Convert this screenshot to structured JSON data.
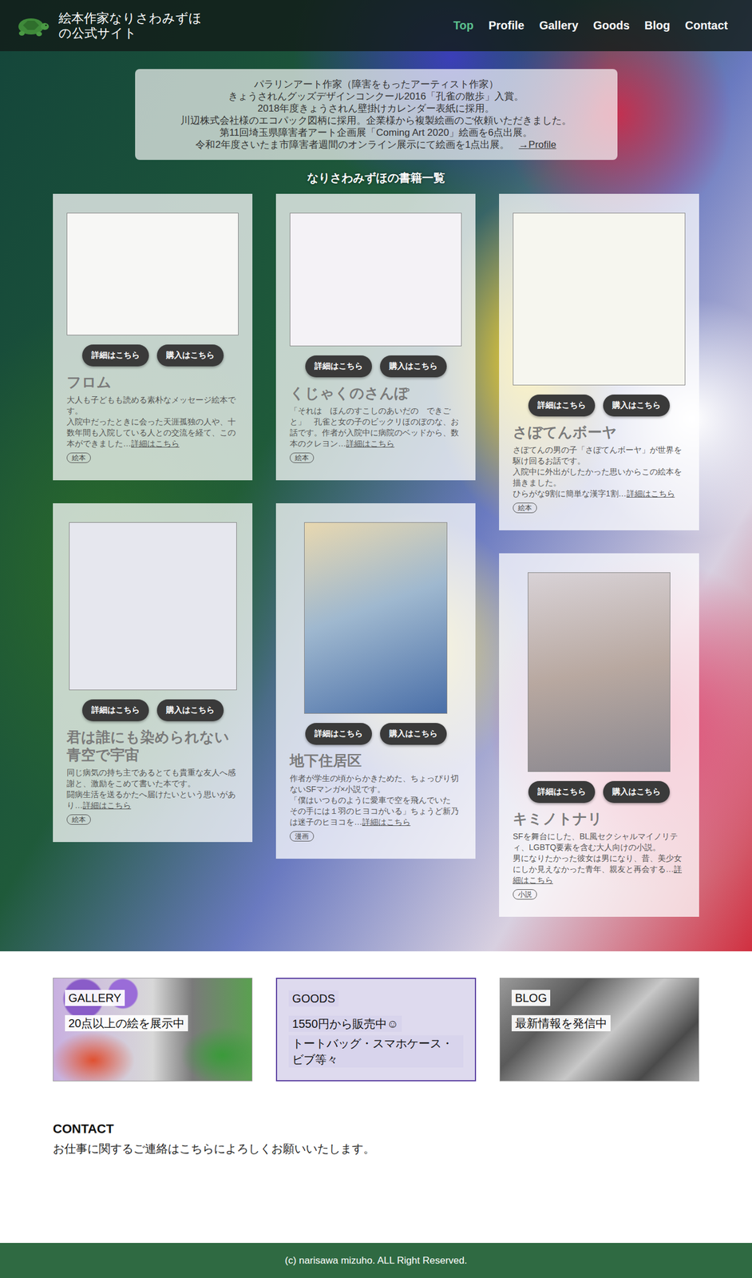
{
  "header": {
    "title_lines": [
      "絵本作家なりさわみずほ",
      "の公式サイト"
    ],
    "nav": [
      {
        "label": "Top",
        "selected": true
      },
      {
        "label": "Profile",
        "selected": false
      },
      {
        "label": "Gallery",
        "selected": false
      },
      {
        "label": "Goods",
        "selected": false
      },
      {
        "label": "Blog",
        "selected": false
      },
      {
        "label": "Contact",
        "selected": false
      }
    ]
  },
  "intro": {
    "lines": [
      "パラリンアート作家（障害をもったアーティスト作家）",
      "きょうされんグッズデザインコンクール2016「孔雀の散歩」入賞。",
      "2018年度きょうされん壁掛けカレンダー表紙に採用。",
      "川辺株式会社様のエコパック図柄に採用。企業様から複製絵画のご依頼いただきました。",
      "第11回埼玉県障害者アート企画展「Coming Art 2020」絵画を6点出展。",
      "令和2年度さいたま市障害者週間のオンライン展示にて絵画を1点出展。"
    ],
    "link": "→Profile"
  },
  "books_heading": "なりさわみずほの書籍一覧",
  "books": [
    {
      "title": "フロム",
      "paragraphs": [
        "大人も子どもも読める素朴なメッセージ絵本です。",
        "入院中だったときに会った天涯孤独の人や、十数年間も入院している人との交流を経て、この本ができました…"
      ],
      "more": "詳細はこちら",
      "tag": "絵本",
      "buttons": [
        "詳細はこちら",
        "購入はこちら"
      ]
    },
    {
      "title": "くじゃくのさんぽ",
      "paragraphs": [
        "「それは　ほんのすこしのあいだの　できごと」　孔雀と女の子のビックリほのぼのな、お話です。作者が入院中に病院のベッドから、数本のクレヨン…"
      ],
      "more": "詳細はこちら",
      "tag": "絵本",
      "buttons": [
        "詳細はこちら",
        "購入はこちら"
      ]
    },
    {
      "title": "さぼてんボーヤ",
      "paragraphs": [
        "さぼてんの男の子「さぼてんボーヤ」が世界を駆け回るお話です。",
        "入院中に外出がしたかった思いからこの絵本を描きました。",
        "ひらがな9割に簡単な漢字1割…"
      ],
      "more": "詳細はこちら",
      "tag": "絵本",
      "buttons": [
        "詳細はこちら",
        "購入はこちら"
      ]
    },
    {
      "title": "君は誰にも染められない青空で宇宙",
      "paragraphs": [
        "同じ病気の持ち主であるとても貴重な友人へ感謝と、激励をこめて書いた本です。",
        "闘病生活を送るかたへ届けたいという思いがあり…"
      ],
      "more": "詳細はこちら",
      "tag": "絵本",
      "buttons": [
        "詳細はこちら",
        "購入はこちら"
      ]
    },
    {
      "title": "地下住居区",
      "paragraphs": [
        "作者が学生の頃からかきためた、ちょっぴり切ないSFマンガ×小説です。",
        "「僕はいつものように愛車で空を飛んでいた　その手には１羽のヒヨコがいる」ちょうど新乃は迷子のヒヨコを…"
      ],
      "more": "詳細はこちら",
      "tag": "漫画",
      "buttons": [
        "詳細はこちら",
        "購入はこちら"
      ]
    },
    {
      "title": "キミノトナリ",
      "paragraphs": [
        "SFを舞台にした、BL風セクシャルマイノリティ、LGBTQ要素を含む大人向けの小説。",
        "男になりたかった彼女は男になり、昔、美少女にしか見えなかった青年、親友と再会する…"
      ],
      "more": "詳細はこちら",
      "tag": "小説",
      "buttons": [
        "詳細はこちら",
        "購入はこちら"
      ]
    }
  ],
  "banners": [
    {
      "title": "GALLERY",
      "lines": [
        "20点以上の絵を展示中"
      ],
      "kind": "gallery"
    },
    {
      "title": "GOODS",
      "lines": [
        "1550円から販売中☺",
        "トートバッグ・スマホケース・ビブ等々"
      ],
      "kind": "goods"
    },
    {
      "title": "BLOG",
      "lines": [
        "最新情報を発信中"
      ],
      "kind": "blog"
    }
  ],
  "contact": {
    "heading": "CONTACT",
    "text": "お仕事に関するご連絡はこちらによろしくお願いいたします。"
  },
  "footer": "(c) narisawa mizuho. ALL Right Reserved."
}
